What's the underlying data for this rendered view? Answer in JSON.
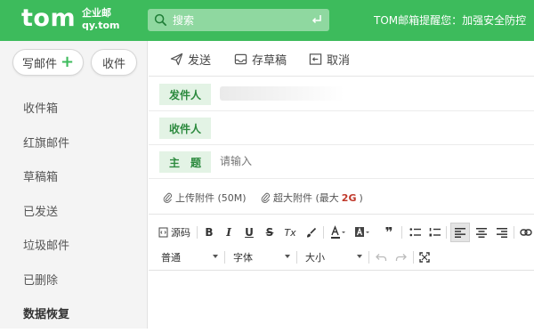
{
  "header": {
    "logo_main": "tom",
    "logo_line1": "企业邮",
    "logo_line2": "qy.tom",
    "search_placeholder": "搜索",
    "notice": "TOM邮箱提醒您：加强安全防控",
    "bar_color": "#3dbb5c"
  },
  "sidebar": {
    "compose_label": "写邮件",
    "compose_plus": "+",
    "receive_label": "收件",
    "items": [
      {
        "label": "收件箱"
      },
      {
        "label": "红旗邮件"
      },
      {
        "label": "草稿箱"
      },
      {
        "label": "已发送"
      },
      {
        "label": "垃圾邮件"
      },
      {
        "label": "已删除"
      },
      {
        "label": "数据恢复"
      }
    ]
  },
  "toolbar": {
    "send_label": "发送",
    "draft_label": "存草稿",
    "cancel_label": "取消"
  },
  "form": {
    "from_label": "发件人",
    "to_label": "收件人",
    "subject_label": "主　题",
    "subject_placeholder": "请输入"
  },
  "attachments": {
    "upload_label": "上传附件 (50M)",
    "large_label_prefix": "超大附件 (最大",
    "large_label_size": "2G",
    "large_label_suffix": ")"
  },
  "editor": {
    "source_label": "源码",
    "bold": "B",
    "italic": "I",
    "underline": "U",
    "strike": "S",
    "clear_format": "Tx",
    "quote": "❞",
    "paragraph_select": "普通",
    "font_select": "字体",
    "size_select": "大小"
  }
}
